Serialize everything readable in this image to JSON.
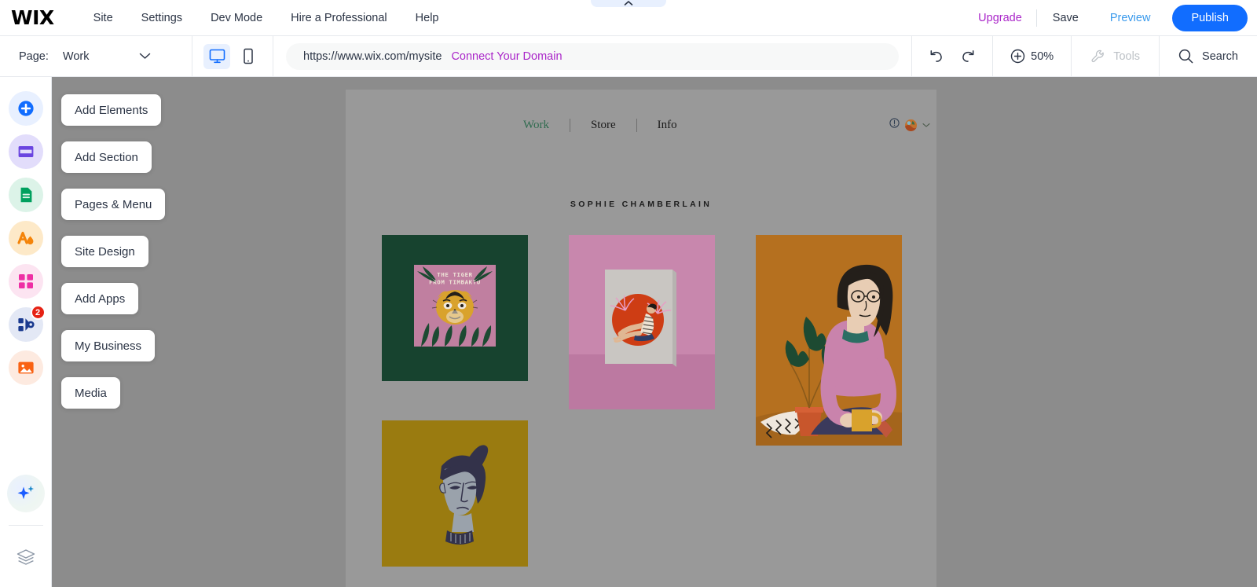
{
  "topbar": {
    "logo": "WIX",
    "menu": [
      {
        "label": "Site",
        "name": "topmenu-site"
      },
      {
        "label": "Settings",
        "name": "topmenu-settings"
      },
      {
        "label": "Dev Mode",
        "name": "topmenu-dev-mode"
      },
      {
        "label": "Hire a Professional",
        "name": "topmenu-hire-a-professional"
      },
      {
        "label": "Help",
        "name": "topmenu-help"
      }
    ],
    "upgrade": "Upgrade",
    "save": "Save",
    "preview": "Preview",
    "publish": "Publish",
    "colors": {
      "upgrade": "#aa26c9",
      "preview": "#3899ec",
      "publish_bg": "#116dff"
    }
  },
  "secondbar": {
    "page_label": "Page:",
    "page_value": "Work",
    "url": "https://www.wix.com/mysite",
    "connect_domain": "Connect Your Domain",
    "zoom": "50%",
    "tools": "Tools",
    "search": "Search",
    "device_desktop": "Desktop",
    "device_mobile": "Mobile"
  },
  "sidebar": {
    "items": [
      {
        "label": "Add Elements",
        "icon": "plus-circle-icon",
        "name": "sidebar-item-add-elements",
        "bg": "#e8f0ff",
        "fg": "#116dff"
      },
      {
        "label": "Add Section",
        "icon": "section-icon",
        "name": "sidebar-item-add-section",
        "bg": "#e2ddfb",
        "fg": "#6a45e0"
      },
      {
        "label": "Pages & Menu",
        "icon": "page-document-icon",
        "name": "sidebar-item-pages-and-menu",
        "bg": "#dcf3e8",
        "fg": "#00a05e"
      },
      {
        "label": "Site Design",
        "icon": "theme-paint-icon",
        "name": "sidebar-item-site-design",
        "bg": "#fde9c8",
        "fg": "#f4840a"
      },
      {
        "label": "Add Apps",
        "icon": "apps-grid-icon",
        "name": "sidebar-item-add-apps",
        "bg": "#fce4f1",
        "fg": "#ee2fa4"
      },
      {
        "label": "My Business",
        "icon": "business-puzzle-icon",
        "name": "sidebar-item-my-business",
        "bg": "#e3e8f5",
        "fg": "#1a3a8f",
        "badge": "2"
      },
      {
        "label": "Media",
        "icon": "media-image-icon",
        "name": "sidebar-item-media",
        "bg": "#fdeae0",
        "fg": "#f96213"
      }
    ],
    "ai_assistant": "AI Assistant",
    "layers": "Layers"
  },
  "site": {
    "nav": [
      {
        "label": "Work",
        "active": true
      },
      {
        "label": "Store",
        "active": false
      },
      {
        "label": "Info",
        "active": false
      }
    ],
    "brand_title": "SOPHIE CHAMBERLAIN",
    "artworks": [
      {
        "name": "artwork-tiger-book-cover",
        "caption": "THE TIGER FROM TIMBAKTU",
        "bg": "#17432f"
      },
      {
        "name": "artwork-sunset-poster-mockup",
        "caption": "",
        "bg": "#c887ad"
      },
      {
        "name": "artwork-woman-with-plant",
        "caption": "",
        "bg": "#b5701f"
      },
      {
        "name": "artwork-portrait-topknot",
        "caption": "",
        "bg": "#9a7b10"
      }
    ]
  }
}
